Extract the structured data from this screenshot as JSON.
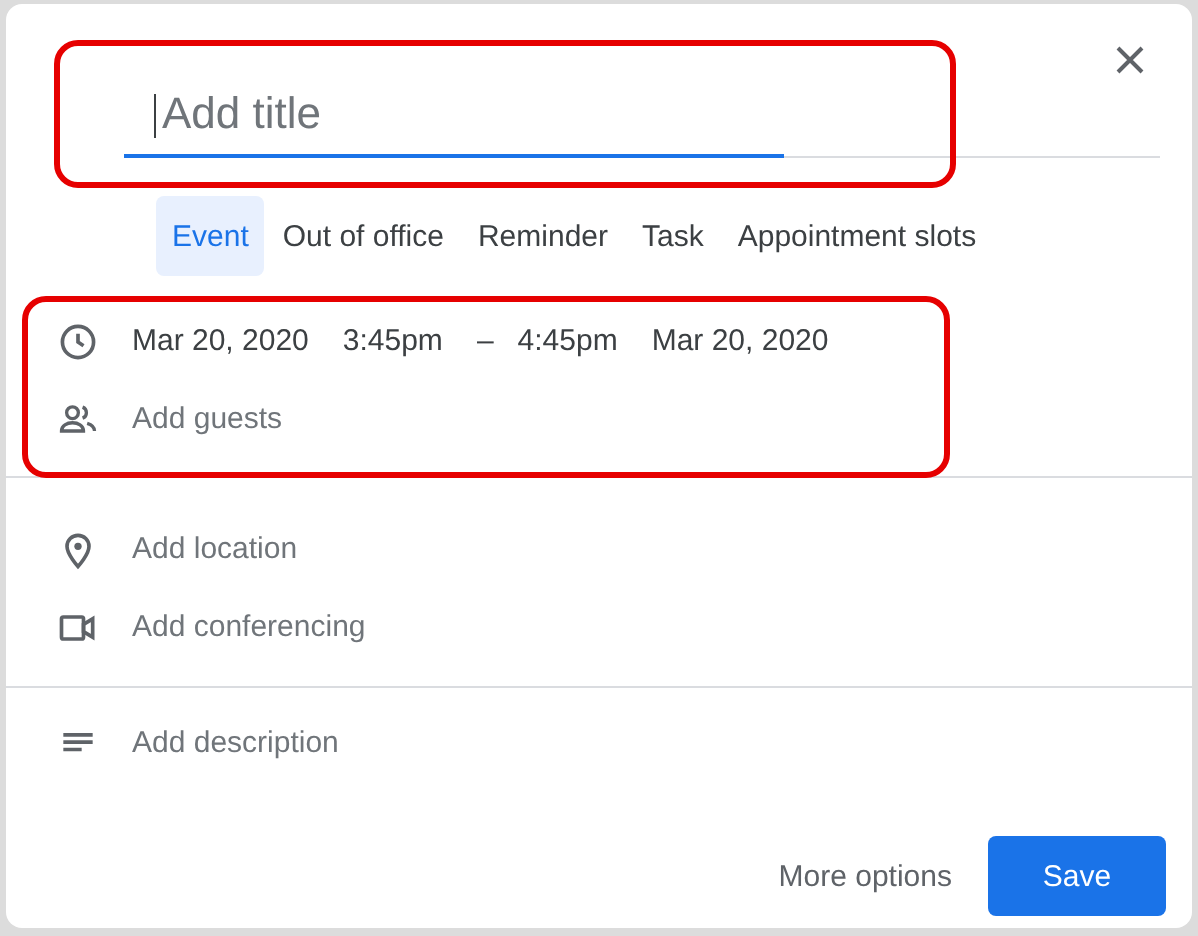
{
  "title_field": {
    "placeholder": "Add title",
    "focused": true,
    "highlighted": true
  },
  "tabs": [
    {
      "label": "Event",
      "selected": true
    },
    {
      "label": "Out of office",
      "selected": false
    },
    {
      "label": "Reminder",
      "selected": false
    },
    {
      "label": "Task",
      "selected": false
    },
    {
      "label": "Appointment slots",
      "selected": false
    }
  ],
  "sections": [
    {
      "highlighted": true,
      "rows": [
        {
          "kind": "datetime",
          "parts": [
            "Mar 20, 2020",
            "3:45pm",
            "–",
            "4:45pm",
            "Mar 20, 2020"
          ]
        },
        {
          "kind": "placeholder",
          "text": "Add guests"
        }
      ]
    },
    {
      "highlighted": false,
      "rows": [
        {
          "kind": "placeholder",
          "text": "Add location"
        },
        {
          "kind": "placeholder",
          "text": "Add conferencing"
        }
      ]
    },
    {
      "highlighted": false,
      "rows": [
        {
          "kind": "placeholder",
          "text": "Add description"
        }
      ]
    }
  ],
  "buttons": [
    {
      "label": "More options",
      "kind": "text"
    },
    {
      "label": "Save",
      "kind": "primary"
    }
  ]
}
